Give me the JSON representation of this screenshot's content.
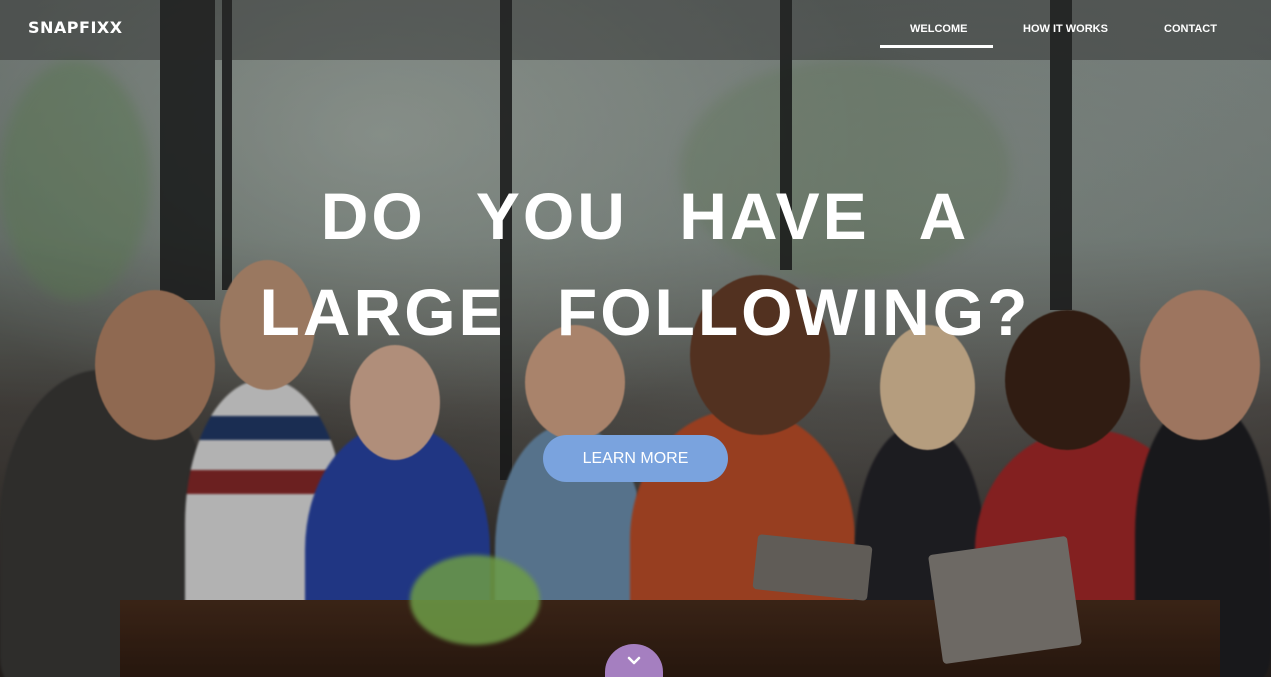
{
  "brand": {
    "logo": "SNAPFIXX"
  },
  "nav": {
    "items": [
      {
        "label": "WELCOME",
        "active": true
      },
      {
        "label": "HOW IT WORKS",
        "active": false
      },
      {
        "label": "CONTACT",
        "active": false
      }
    ]
  },
  "hero": {
    "headline_line1": "DO YOU HAVE A",
    "headline_line2": "LARGE FOLLOWING?",
    "cta_label": "LEARN MORE"
  },
  "colors": {
    "cta_background": "#7aa3de",
    "scroll_tab": "#a57fc0",
    "text": "#ffffff"
  },
  "icons": {
    "scroll_down": "chevron-down-icon"
  }
}
